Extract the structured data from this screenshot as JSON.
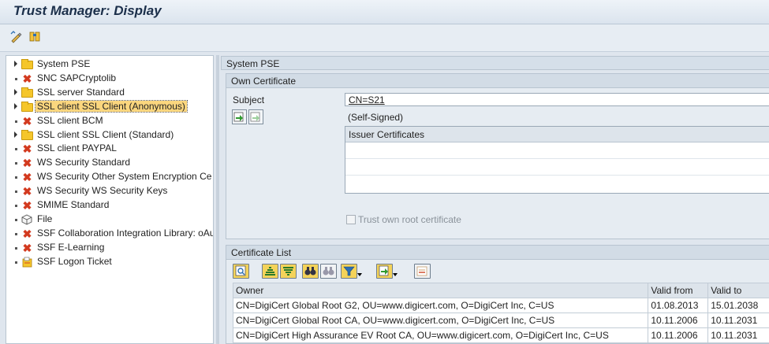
{
  "window": {
    "title": "Trust Manager: Display"
  },
  "toolbar": {
    "buttons": [
      "change-display-icon",
      "where-used-icon"
    ]
  },
  "tree": {
    "items": [
      {
        "label": "System PSE",
        "icon": "folder",
        "expander": "arrow"
      },
      {
        "label": "SNC SAPCryptolib",
        "icon": "x",
        "expander": "dot"
      },
      {
        "label": "SSL server Standard",
        "icon": "folder",
        "expander": "arrow"
      },
      {
        "label": "SSL client SSL Client (Anonymous)",
        "icon": "folder",
        "expander": "arrow",
        "selected": true
      },
      {
        "label": "SSL client BCM",
        "icon": "x",
        "expander": "dot"
      },
      {
        "label": "SSL client SSL Client (Standard)",
        "icon": "folder",
        "expander": "arrow"
      },
      {
        "label": "SSL client PAYPAL",
        "icon": "x",
        "expander": "dot"
      },
      {
        "label": "WS Security Standard",
        "icon": "x",
        "expander": "dot"
      },
      {
        "label": "WS Security Other System Encryption Ce",
        "icon": "x",
        "expander": "dot"
      },
      {
        "label": "WS Security WS Security Keys",
        "icon": "x",
        "expander": "dot"
      },
      {
        "label": "SMIME Standard",
        "icon": "x",
        "expander": "dot"
      },
      {
        "label": "File",
        "icon": "cube",
        "expander": "dot"
      },
      {
        "label": "SSF Collaboration Integration Library: oAu",
        "icon": "x",
        "expander": "dot"
      },
      {
        "label": "SSF E-Learning",
        "icon": "x",
        "expander": "dot"
      },
      {
        "label": "SSF Logon Ticket",
        "icon": "ticket",
        "expander": "dot"
      }
    ]
  },
  "pse": {
    "title": "System PSE",
    "own_certificate": {
      "heading": "Own Certificate",
      "subject_label": "Subject",
      "subject_value": "CN=S21",
      "self_signed": "(Self-Signed)",
      "issuer_header": "Issuer Certificates",
      "trust_root_label": "Trust own root certificate"
    },
    "certificate_list": {
      "heading": "Certificate List",
      "columns": [
        "Owner",
        "Valid from",
        "Valid to"
      ],
      "rows": [
        {
          "owner": "CN=DigiCert Global Root G2, OU=www.digicert.com, O=DigiCert Inc, C=US",
          "from": "01.08.2013",
          "to": "15.01.2038"
        },
        {
          "owner": "CN=DigiCert Global Root CA, OU=www.digicert.com, O=DigiCert Inc, C=US",
          "from": "10.11.2006",
          "to": "10.11.2031"
        },
        {
          "owner": "CN=DigiCert High Assurance EV Root CA, OU=www.digicert.com, O=DigiCert Inc, C=US",
          "from": "10.11.2006",
          "to": "10.11.2031"
        }
      ]
    }
  },
  "colors": {
    "selected": "#fbd67e",
    "folder": "#f5c62b",
    "error": "#d33a1f"
  }
}
